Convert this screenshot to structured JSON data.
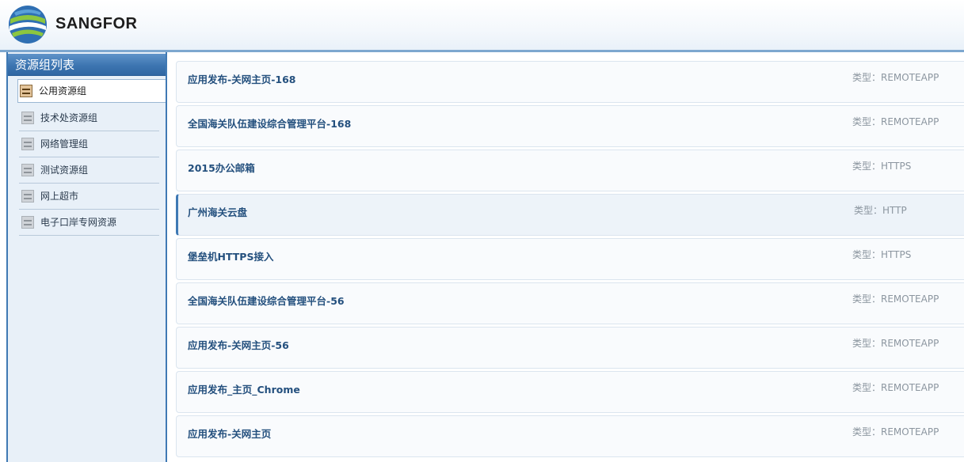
{
  "header": {
    "logo_text": "SANGFOR"
  },
  "sidebar": {
    "title": "资源组列表",
    "items": [
      {
        "label": "公用资源组",
        "active": true
      },
      {
        "label": "技术处资源组",
        "active": false
      },
      {
        "label": "网络管理组",
        "active": false
      },
      {
        "label": "测试资源组",
        "active": false
      },
      {
        "label": "网上超市",
        "active": false
      },
      {
        "label": "电子口岸专网资源",
        "active": false
      }
    ]
  },
  "resources": [
    {
      "name": "应用发布-关网主页-168",
      "type": "类型：REMOTEAPP"
    },
    {
      "name": "全国海关队伍建设综合管理平台-168",
      "type": "类型：REMOTEAPP"
    },
    {
      "name": "2015办公邮箱",
      "type": "类型：HTTPS"
    },
    {
      "name": "广州海关云盘",
      "type": "类型：HTTP"
    },
    {
      "name": "堡垒机HTTPS接入",
      "type": "类型：HTTPS"
    },
    {
      "name": "全国海关队伍建设综合管理平台-56",
      "type": "类型：REMOTEAPP"
    },
    {
      "name": "应用发布-关网主页-56",
      "type": "类型：REMOTEAPP"
    },
    {
      "name": "应用发布_主页_Chrome",
      "type": "类型：REMOTEAPP"
    },
    {
      "name": "应用发布-关网主页",
      "type": "类型：REMOTEAPP"
    }
  ],
  "colors": {
    "accent": "#3f79b4",
    "link": "#24507e"
  }
}
